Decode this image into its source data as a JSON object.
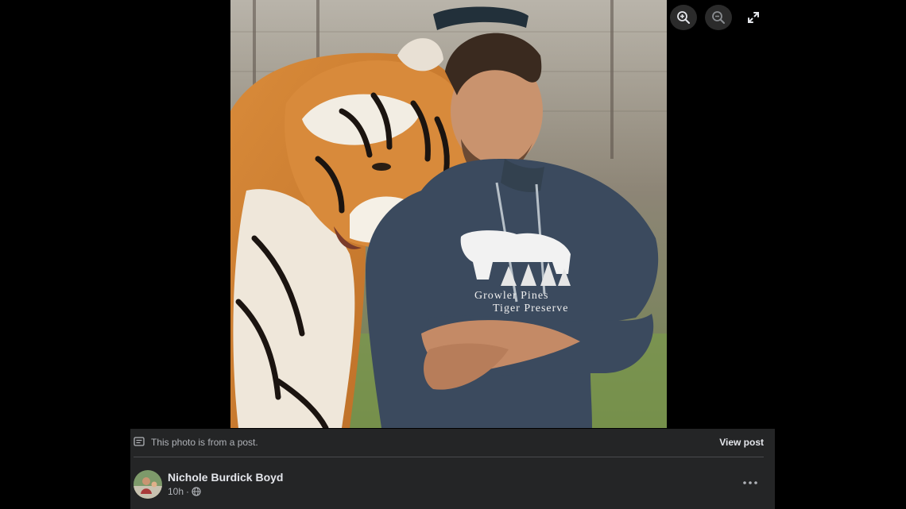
{
  "photo": {
    "hoodie_text_line1": "Growler Pines",
    "hoodie_text_line2": "Tiger Preserve"
  },
  "controls": {
    "zoom_in_icon": "zoom-in-icon",
    "zoom_out_icon": "zoom-out-icon",
    "fullscreen_icon": "fullscreen-icon"
  },
  "post_bar": {
    "notice": "This photo is from a post.",
    "view_post": "View post",
    "author": "Nichole Burdick Boyd",
    "time": "10h",
    "separator": "·",
    "privacy_icon": "globe-icon",
    "more_icon": "more-options-icon"
  },
  "colors": {
    "background": "#000000",
    "bar": "#242526",
    "primary_text": "#e4e6eb",
    "secondary_text": "#b0b3b8"
  }
}
